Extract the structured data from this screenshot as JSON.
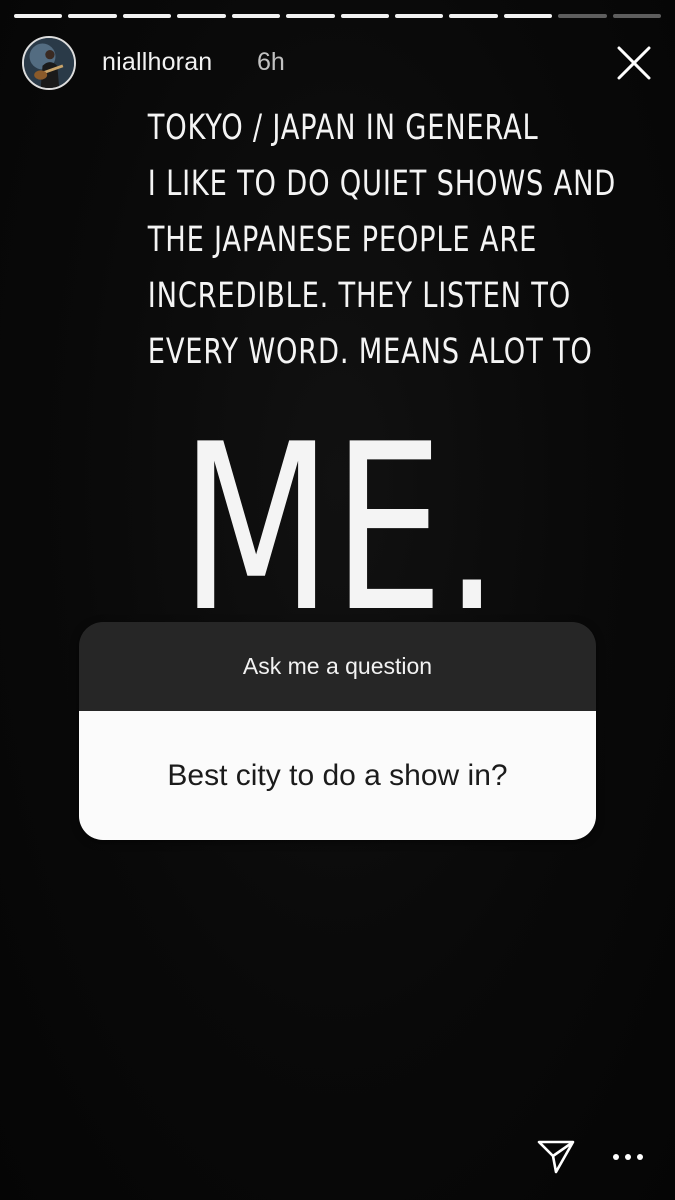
{
  "progress": {
    "total_segments": 12,
    "completed_segments": 10
  },
  "header": {
    "username": "niallhoran",
    "time_ago": "6h",
    "avatar_icon": "guitarist-photo-avatar",
    "close_icon": "close-icon"
  },
  "caption": {
    "lines": [
      "TOKYO / JAPAN IN GENERAL",
      "I LIKE TO DO QUIET SHOWS AND",
      "THE JAPANESE PEOPLE ARE",
      "INCREDIBLE. THEY LISTEN TO",
      "EVERY WORD. MEANS ALOT TO"
    ],
    "big_word": "ME."
  },
  "question_sticker": {
    "prompt": "Ask me a question",
    "question": "Best city to do a show in?"
  },
  "footer": {
    "send_icon": "direct-send-icon",
    "more_icon": "more-options-icon"
  },
  "colors": {
    "background": "#0a0a0a",
    "text": "#f4f4f4",
    "sticker_header": "#262626",
    "sticker_body": "#fbfbfb"
  }
}
